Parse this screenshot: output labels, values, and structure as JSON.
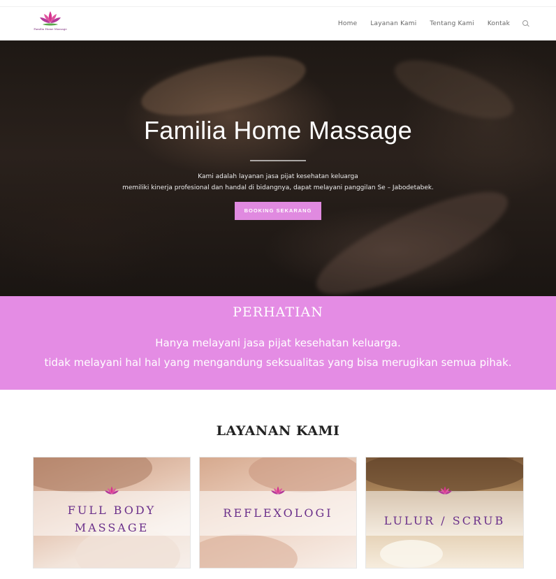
{
  "brand": {
    "logo_text": "Familia Home Massage",
    "accent_color": "#e08ae0",
    "logo_icon": "lotus-icon"
  },
  "nav": {
    "items": [
      "Home",
      "Layanan Kami",
      "Tentang Kami",
      "Kontak"
    ],
    "search_icon": "search-icon"
  },
  "hero": {
    "title": "Familia Home Massage",
    "desc_line1": "Kami adalah layanan jasa pijat kesehatan keluarga",
    "desc_line2": "memiliki kinerja profesional dan handal di bidangnya, dapat melayani panggilan Se – Jabodetabek.",
    "cta_label": "BOOKING SEKARANG"
  },
  "notice": {
    "title": "PERHATIAN",
    "line1": "Hanya melayani jasa pijat kesehatan keluarga.",
    "line2": "tidak melayani hal hal yang mengandung seksualitas yang bisa merugikan semua pihak.",
    "background_color": "#e48ce4"
  },
  "services": {
    "title": "LAYANAN KAMI",
    "cards": [
      {
        "line1": "FULL BODY",
        "line2": "MASSAGE"
      },
      {
        "line1": "REFLEXOLOGI",
        "line2": ""
      },
      {
        "line1": "LULUR / SCRUB",
        "line2": ""
      }
    ]
  }
}
